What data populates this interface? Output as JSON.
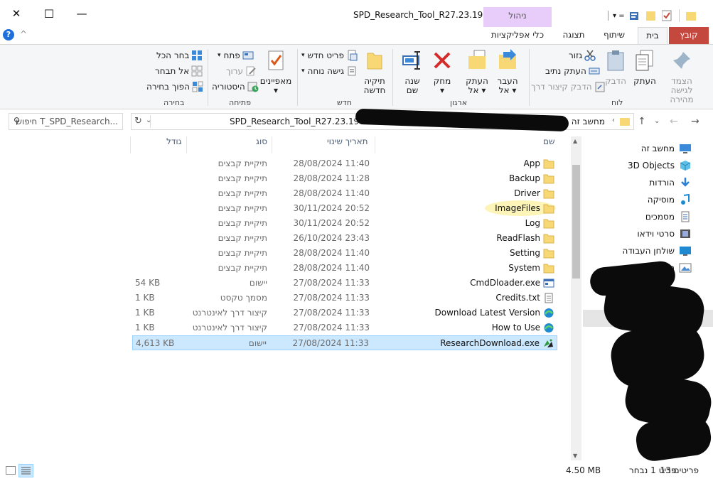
{
  "window": {
    "title": "SPD_Research_Tool_R27.23.1902",
    "close_glyph": "✕",
    "max_glyph": "☐",
    "min_glyph": "—",
    "help_glyph": "?",
    "collapse_glyph": "^"
  },
  "context_group": "ניהול",
  "tabs": {
    "file": "קובץ",
    "home": "בית",
    "share": "שיתוף",
    "view": "תצוגה",
    "app_tools": "כלי אפליקציות"
  },
  "ribbon": {
    "clipboard": {
      "group": "לוח",
      "pin": "הצמד לגישה מהירה",
      "copy": "העתק",
      "paste": "הדבק",
      "cut": "גזור",
      "copy_path": "העתק נתיב",
      "paste_shortcut": "הדבק קיצור דרך"
    },
    "organize": {
      "group": "ארגון",
      "move_to_1": "העבר",
      "move_to_2": "אל",
      "copy_to_1": "העתק",
      "copy_to_2": "אל",
      "delete": "מחק",
      "rename_1": "שנה",
      "rename_2": "שם"
    },
    "new": {
      "group": "חדש",
      "new_folder_1": "תיקיה",
      "new_folder_2": "חדשה",
      "new_item": "פריט חדש",
      "easy_access": "גישה נוחה"
    },
    "open": {
      "group": "פתיחה",
      "properties": "מאפיינים",
      "open": "פתח",
      "edit": "ערוך",
      "history": "היסטוריה"
    },
    "select": {
      "group": "בחירה",
      "select_all": "בחר הכל",
      "select_none": "אל תבחר",
      "invert": "הפוך בחירה"
    }
  },
  "address": {
    "path": "SPD_Research_Tool_R27.23.1902",
    "root": "מחשב זה",
    "search_placeholder": "חיפוש T_SPD_Research..."
  },
  "columns": {
    "name": "שם",
    "date": "תאריך שינוי",
    "type": "סוג",
    "size": "גודל"
  },
  "files": [
    {
      "name": "App",
      "date": "28/08/2024 11:40",
      "type": "תיקיית קבצים",
      "size": "",
      "kind": "folder"
    },
    {
      "name": "Backup",
      "date": "28/08/2024 11:28",
      "type": "תיקיית קבצים",
      "size": "",
      "kind": "folder"
    },
    {
      "name": "Driver",
      "date": "28/08/2024 11:40",
      "type": "תיקיית קבצים",
      "size": "",
      "kind": "folder"
    },
    {
      "name": "ImageFiles",
      "date": "30/11/2024 20:52",
      "type": "תיקיית קבצים",
      "size": "",
      "kind": "folder"
    },
    {
      "name": "Log",
      "date": "30/11/2024 20:52",
      "type": "תיקיית קבצים",
      "size": "",
      "kind": "folder"
    },
    {
      "name": "ReadFlash",
      "date": "26/10/2024 23:43",
      "type": "תיקיית קבצים",
      "size": "",
      "kind": "folder"
    },
    {
      "name": "Setting",
      "date": "28/08/2024 11:40",
      "type": "תיקיית קבצים",
      "size": "",
      "kind": "folder"
    },
    {
      "name": "System",
      "date": "28/08/2024 11:40",
      "type": "תיקיית קבצים",
      "size": "",
      "kind": "folder"
    },
    {
      "name": "CmdDloader.exe",
      "date": "27/08/2024 11:33",
      "type": "יישום",
      "size": "54 KB",
      "kind": "exe"
    },
    {
      "name": "Credits.txt",
      "date": "27/08/2024 11:33",
      "type": "מסמך טקסט",
      "size": "1 KB",
      "kind": "txt"
    },
    {
      "name": "Download Latest Version",
      "date": "27/08/2024 11:33",
      "type": "קיצור דרך לאינטרנט",
      "size": "1 KB",
      "kind": "url"
    },
    {
      "name": "How to Use",
      "date": "27/08/2024 11:33",
      "type": "קיצור דרך לאינטרנט",
      "size": "1 KB",
      "kind": "url"
    },
    {
      "name": "ResearchDownload.exe",
      "date": "27/08/2024 11:33",
      "type": "יישום",
      "size": "4,613 KB",
      "kind": "app"
    }
  ],
  "selected_index": 12,
  "nav": [
    {
      "label": "מחשב זה",
      "icon": "pc-icon"
    },
    {
      "label": "3D Objects",
      "icon": "cube-icon"
    },
    {
      "label": "הורדות",
      "icon": "download-icon"
    },
    {
      "label": "מוסיקה",
      "icon": "music-icon"
    },
    {
      "label": "מסמכים",
      "icon": "document-icon"
    },
    {
      "label": "סרטי וידאו",
      "icon": "video-icon"
    },
    {
      "label": "שולחן העבודה",
      "icon": "desktop-icon"
    },
    {
      "label": "תמונות",
      "icon": "pictures-icon"
    }
  ],
  "status": {
    "count": "13 פריטים",
    "selection": "פריט 1 נבחר",
    "size": "4.50 MB"
  },
  "colors": {
    "file_tab": "#c4483e",
    "context": "#e8cdfa",
    "selection": "#cce8ff",
    "folder": "#f8d775"
  }
}
